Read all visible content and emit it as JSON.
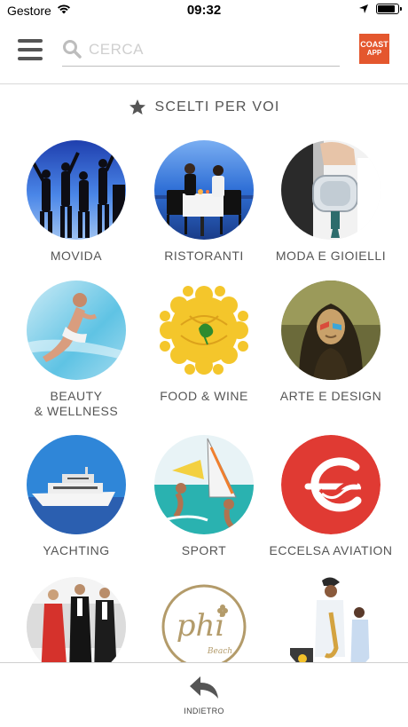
{
  "status_bar": {
    "carrier": "Gestore",
    "time": "09:32"
  },
  "header": {
    "search_placeholder": "CERCA",
    "logo_line1": "COAST",
    "logo_line2": "APP"
  },
  "section": {
    "title": "SCELTI PER VOI"
  },
  "categories": [
    {
      "label": "MOVIDA"
    },
    {
      "label": "RISTORANTI"
    },
    {
      "label": "MODA E GIOIELLI"
    },
    {
      "label": "BEAUTY\n& WELLNESS"
    },
    {
      "label": "FOOD & WINE"
    },
    {
      "label": "ARTE E DESIGN"
    },
    {
      "label": "YACHTING"
    },
    {
      "label": "SPORT"
    },
    {
      "label": "ECCELSA AVIATION"
    },
    {
      "label": ""
    },
    {
      "label": ""
    },
    {
      "label": ""
    }
  ],
  "images": {
    "phi_text": "phi",
    "phi_sub": "Beach"
  },
  "bottom_bar": {
    "back_label": "INDIETRO"
  },
  "colors": {
    "logo": "#e4572e",
    "text": "#555555",
    "aviation_red": "#e03a33"
  }
}
